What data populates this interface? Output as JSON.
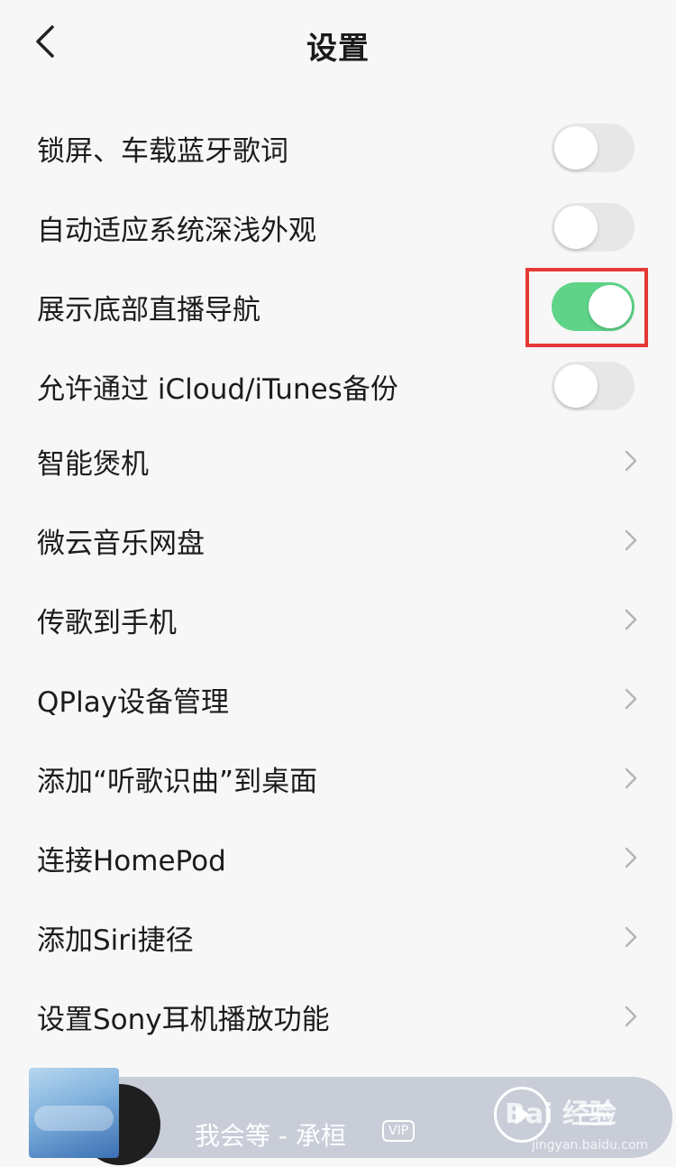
{
  "header": {
    "title": "设置",
    "back_icon": "chevron-left-icon"
  },
  "toggles": [
    {
      "label": "锁屏、车载蓝牙歌词",
      "on": false
    },
    {
      "label": "自动适应系统深浅外观",
      "on": false
    },
    {
      "label": "展示底部直播导航",
      "on": true
    },
    {
      "label": "允许通过 iCloud/iTunes备份",
      "on": false
    }
  ],
  "links": [
    {
      "label": "智能煲机"
    },
    {
      "label": "微云音乐网盘"
    },
    {
      "label": "传歌到手机"
    },
    {
      "label": "QPlay设备管理"
    },
    {
      "label": "添加“听歌识曲”到桌面"
    },
    {
      "label": "连接HomePod"
    },
    {
      "label": "添加Siri捷径"
    },
    {
      "label": "设置Sony耳机播放功能"
    }
  ],
  "player": {
    "song": "我会等 - 承桓",
    "vip": "VIP"
  },
  "watermark": {
    "text": "Bai 经验",
    "sub": "jingyan.baidu.com"
  },
  "colors": {
    "toggle_on": "#5fd488",
    "toggle_off": "#e7e7e7",
    "highlight": "#e53935"
  }
}
